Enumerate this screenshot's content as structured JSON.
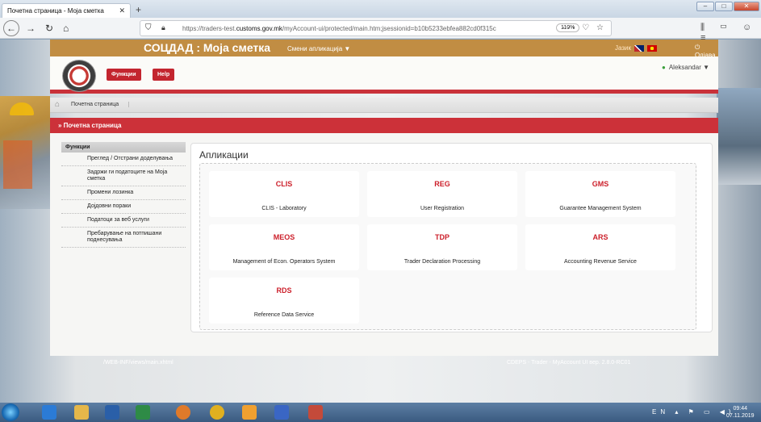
{
  "browser": {
    "tab_title": "Почетна страница - Моја сметка",
    "tab_close": "✕",
    "new_tab": "+",
    "url_prefix": "https://traders-test.",
    "url_domain": "customs.gov.mk",
    "url_rest": "/myAccount-ui/protected/main.htm;jsessionid=b10b5233ebfea882cd0f315c",
    "zoom": "110%",
    "url_icons": "··· ♡ ☆"
  },
  "app": {
    "title": "СОЦДАД : Моја сметка",
    "change_app": "Смени апликација ▼",
    "language_label": "Јазик",
    "logout": "⏻ Одјава",
    "functions_button": "Функции",
    "help_button": "Help",
    "user_name": "Aleksandar ▼",
    "breadcrumb": "Почетна страница",
    "section_title": "» Почетна страница"
  },
  "sidebar": {
    "header": "Функции",
    "items": [
      "Преглед / Отстрани доделувања",
      "Задржи ги податоците на Моја сметка",
      "Промени лозинка",
      "Дојдовни пораки",
      "Податоци за веб услуги",
      "Пребарување на потпишани поднесувања"
    ]
  },
  "panel": {
    "title": "Апликации",
    "apps": [
      {
        "code": "CLIS",
        "name": "CLIS - Laboratory"
      },
      {
        "code": "REG",
        "name": "User Registration"
      },
      {
        "code": "GMS",
        "name": "Guarantee Management System"
      },
      {
        "code": "MEOS",
        "name": "Management of Econ. Operators System"
      },
      {
        "code": "TDP",
        "name": "Trader Declaration Processing"
      },
      {
        "code": "ARS",
        "name": "Accounting Revenue Service"
      },
      {
        "code": "RDS",
        "name": "Reference Data Service"
      }
    ]
  },
  "footer": {
    "left": "/WEB-INF/views/main.xhtml",
    "right": "CDEPS - Trader - MyAccount UI вер. 2.8.0-RC01"
  },
  "taskbar": {
    "lang": "EN",
    "time": "09:44",
    "date": "07.11.2019"
  },
  "colors": {
    "accent_red": "#cc3139",
    "brown_strip": "#c18d43",
    "app_code": "#cc1f2a"
  }
}
